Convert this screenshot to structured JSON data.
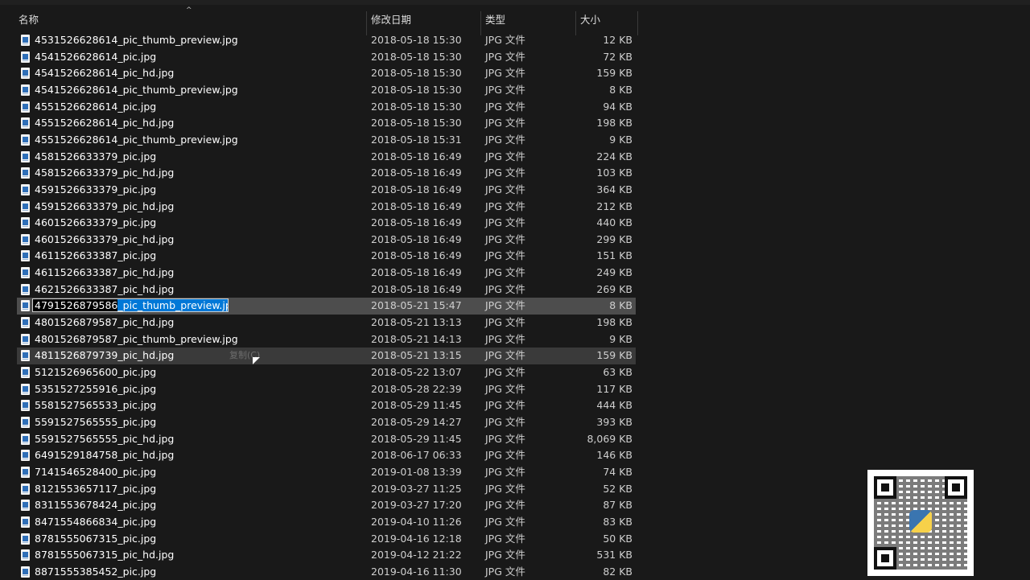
{
  "columns": {
    "name": "名称",
    "date": "修改日期",
    "type": "类型",
    "size": "大小",
    "sort_glyph": "^"
  },
  "files": [
    {
      "name": "4531526628614_pic_thumb_preview.jpg",
      "date": "2018-05-18 15:30",
      "type": "JPG 文件",
      "size": "12 KB"
    },
    {
      "name": "4541526628614_pic.jpg",
      "date": "2018-05-18 15:30",
      "type": "JPG 文件",
      "size": "72 KB"
    },
    {
      "name": "4541526628614_pic_hd.jpg",
      "date": "2018-05-18 15:30",
      "type": "JPG 文件",
      "size": "159 KB"
    },
    {
      "name": "4541526628614_pic_thumb_preview.jpg",
      "date": "2018-05-18 15:30",
      "type": "JPG 文件",
      "size": "8 KB"
    },
    {
      "name": "4551526628614_pic.jpg",
      "date": "2018-05-18 15:30",
      "type": "JPG 文件",
      "size": "94 KB"
    },
    {
      "name": "4551526628614_pic_hd.jpg",
      "date": "2018-05-18 15:30",
      "type": "JPG 文件",
      "size": "198 KB"
    },
    {
      "name": "4551526628614_pic_thumb_preview.jpg",
      "date": "2018-05-18 15:31",
      "type": "JPG 文件",
      "size": "9 KB"
    },
    {
      "name": "4581526633379_pic.jpg",
      "date": "2018-05-18 16:49",
      "type": "JPG 文件",
      "size": "224 KB"
    },
    {
      "name": "4581526633379_pic_hd.jpg",
      "date": "2018-05-18 16:49",
      "type": "JPG 文件",
      "size": "103 KB"
    },
    {
      "name": "4591526633379_pic.jpg",
      "date": "2018-05-18 16:49",
      "type": "JPG 文件",
      "size": "364 KB"
    },
    {
      "name": "4591526633379_pic_hd.jpg",
      "date": "2018-05-18 16:49",
      "type": "JPG 文件",
      "size": "212 KB"
    },
    {
      "name": "4601526633379_pic.jpg",
      "date": "2018-05-18 16:49",
      "type": "JPG 文件",
      "size": "440 KB"
    },
    {
      "name": "4601526633379_pic_hd.jpg",
      "date": "2018-05-18 16:49",
      "type": "JPG 文件",
      "size": "299 KB"
    },
    {
      "name": "4611526633387_pic.jpg",
      "date": "2018-05-18 16:49",
      "type": "JPG 文件",
      "size": "151 KB"
    },
    {
      "name": "4611526633387_pic_hd.jpg",
      "date": "2018-05-18 16:49",
      "type": "JPG 文件",
      "size": "249 KB"
    },
    {
      "name": "4621526633387_pic_hd.jpg",
      "date": "2018-05-18 16:49",
      "type": "JPG 文件",
      "size": "269 KB"
    },
    {
      "name": "4791526879586_pic_thumb_preview.jpg",
      "date": "2018-05-21 15:47",
      "type": "JPG 文件",
      "size": "8 KB",
      "state": "renaming",
      "rename_prefix": "4791526879586",
      "rename_selected": "_pic_thumb_preview.jpg"
    },
    {
      "name": "4801526879587_pic_hd.jpg",
      "date": "2018-05-21 13:13",
      "type": "JPG 文件",
      "size": "198 KB"
    },
    {
      "name": "4801526879587_pic_thumb_preview.jpg",
      "date": "2018-05-21 14:13",
      "type": "JPG 文件",
      "size": "9 KB"
    },
    {
      "name": "4811526879739_pic_hd.jpg",
      "date": "2018-05-21 13:15",
      "type": "JPG 文件",
      "size": "159 KB",
      "state": "hover",
      "ghost": "复制(C)"
    },
    {
      "name": "5121526965600_pic.jpg",
      "date": "2018-05-22 13:07",
      "type": "JPG 文件",
      "size": "63 KB"
    },
    {
      "name": "5351527255916_pic.jpg",
      "date": "2018-05-28 22:39",
      "type": "JPG 文件",
      "size": "117 KB"
    },
    {
      "name": "5581527565533_pic.jpg",
      "date": "2018-05-29 11:45",
      "type": "JPG 文件",
      "size": "444 KB"
    },
    {
      "name": "5591527565555_pic.jpg",
      "date": "2018-05-29 14:27",
      "type": "JPG 文件",
      "size": "393 KB"
    },
    {
      "name": "5591527565555_pic_hd.jpg",
      "date": "2018-05-29 11:45",
      "type": "JPG 文件",
      "size": "8,069 KB"
    },
    {
      "name": "6491529184758_pic_hd.jpg",
      "date": "2018-06-17 06:33",
      "type": "JPG 文件",
      "size": "146 KB"
    },
    {
      "name": "7141546528400_pic.jpg",
      "date": "2019-01-08 13:39",
      "type": "JPG 文件",
      "size": "74 KB"
    },
    {
      "name": "8121553657117_pic.jpg",
      "date": "2019-03-27 11:25",
      "type": "JPG 文件",
      "size": "52 KB"
    },
    {
      "name": "8311553678424_pic.jpg",
      "date": "2019-03-27 17:20",
      "type": "JPG 文件",
      "size": "87 KB"
    },
    {
      "name": "8471554866834_pic.jpg",
      "date": "2019-04-10 11:26",
      "type": "JPG 文件",
      "size": "83 KB"
    },
    {
      "name": "8781555067315_pic.jpg",
      "date": "2019-04-16 12:18",
      "type": "JPG 文件",
      "size": "50 KB"
    },
    {
      "name": "8781555067315_pic_hd.jpg",
      "date": "2019-04-12 21:22",
      "type": "JPG 文件",
      "size": "531 KB"
    },
    {
      "name": "8871555385452_pic.jpg",
      "date": "2019-04-16 11:30",
      "type": "JPG 文件",
      "size": "82 KB"
    }
  ],
  "overlay": {
    "qr_logo_text": "python"
  },
  "colors": {
    "background": "#191919",
    "selected_row": "#4d4d4d",
    "rename_highlight": "#0078d7"
  }
}
